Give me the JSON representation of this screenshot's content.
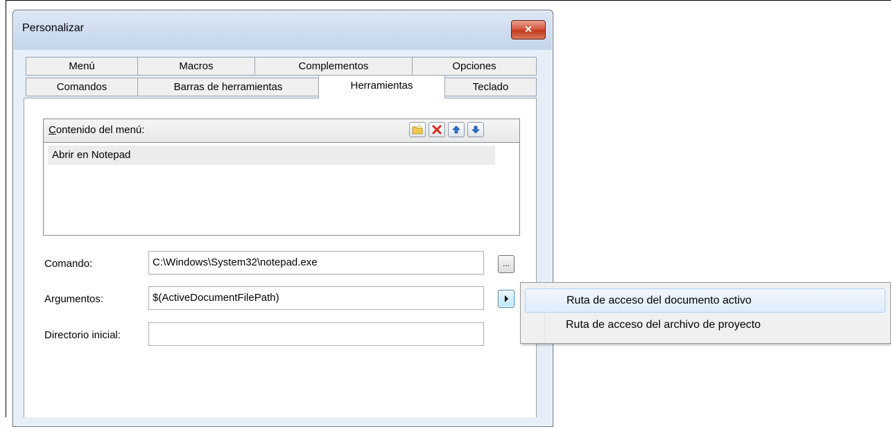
{
  "window": {
    "title": "Personalizar"
  },
  "tabs": {
    "row1": [
      "Menú",
      "Macros",
      "Complementos",
      "Opciones"
    ],
    "row2": [
      "Comandos",
      "Barras de herramientas",
      "Herramientas",
      "Teclado"
    ],
    "active": "Herramientas"
  },
  "menu_panel": {
    "label_prefix": "C",
    "label_rest": "ontenido del menú:",
    "items": [
      "Abrir en Notepad"
    ],
    "toolbar_icons": [
      "new-folder-icon",
      "delete-icon",
      "move-up-icon",
      "move-down-icon"
    ]
  },
  "form": {
    "command_label": "Comando:",
    "command_value": "C:\\Windows\\System32\\notepad.exe",
    "browse_label": "...",
    "arguments_label": "Argumentos:",
    "arguments_value": "$(ActiveDocumentFilePath)",
    "initial_dir_label": "Directorio inicial:",
    "initial_dir_value": ""
  },
  "context_menu": {
    "items": [
      "Ruta de acceso del documento activo",
      "Ruta de acceso del archivo de proyecto"
    ],
    "hovered_index": 0
  },
  "colors": {
    "window_bg": "#e6eef7",
    "close_button": "#c7472d",
    "arrow_icon": "#2f6fd0",
    "delete_icon": "#e0281b",
    "folder_icon": "#f2c94c"
  }
}
